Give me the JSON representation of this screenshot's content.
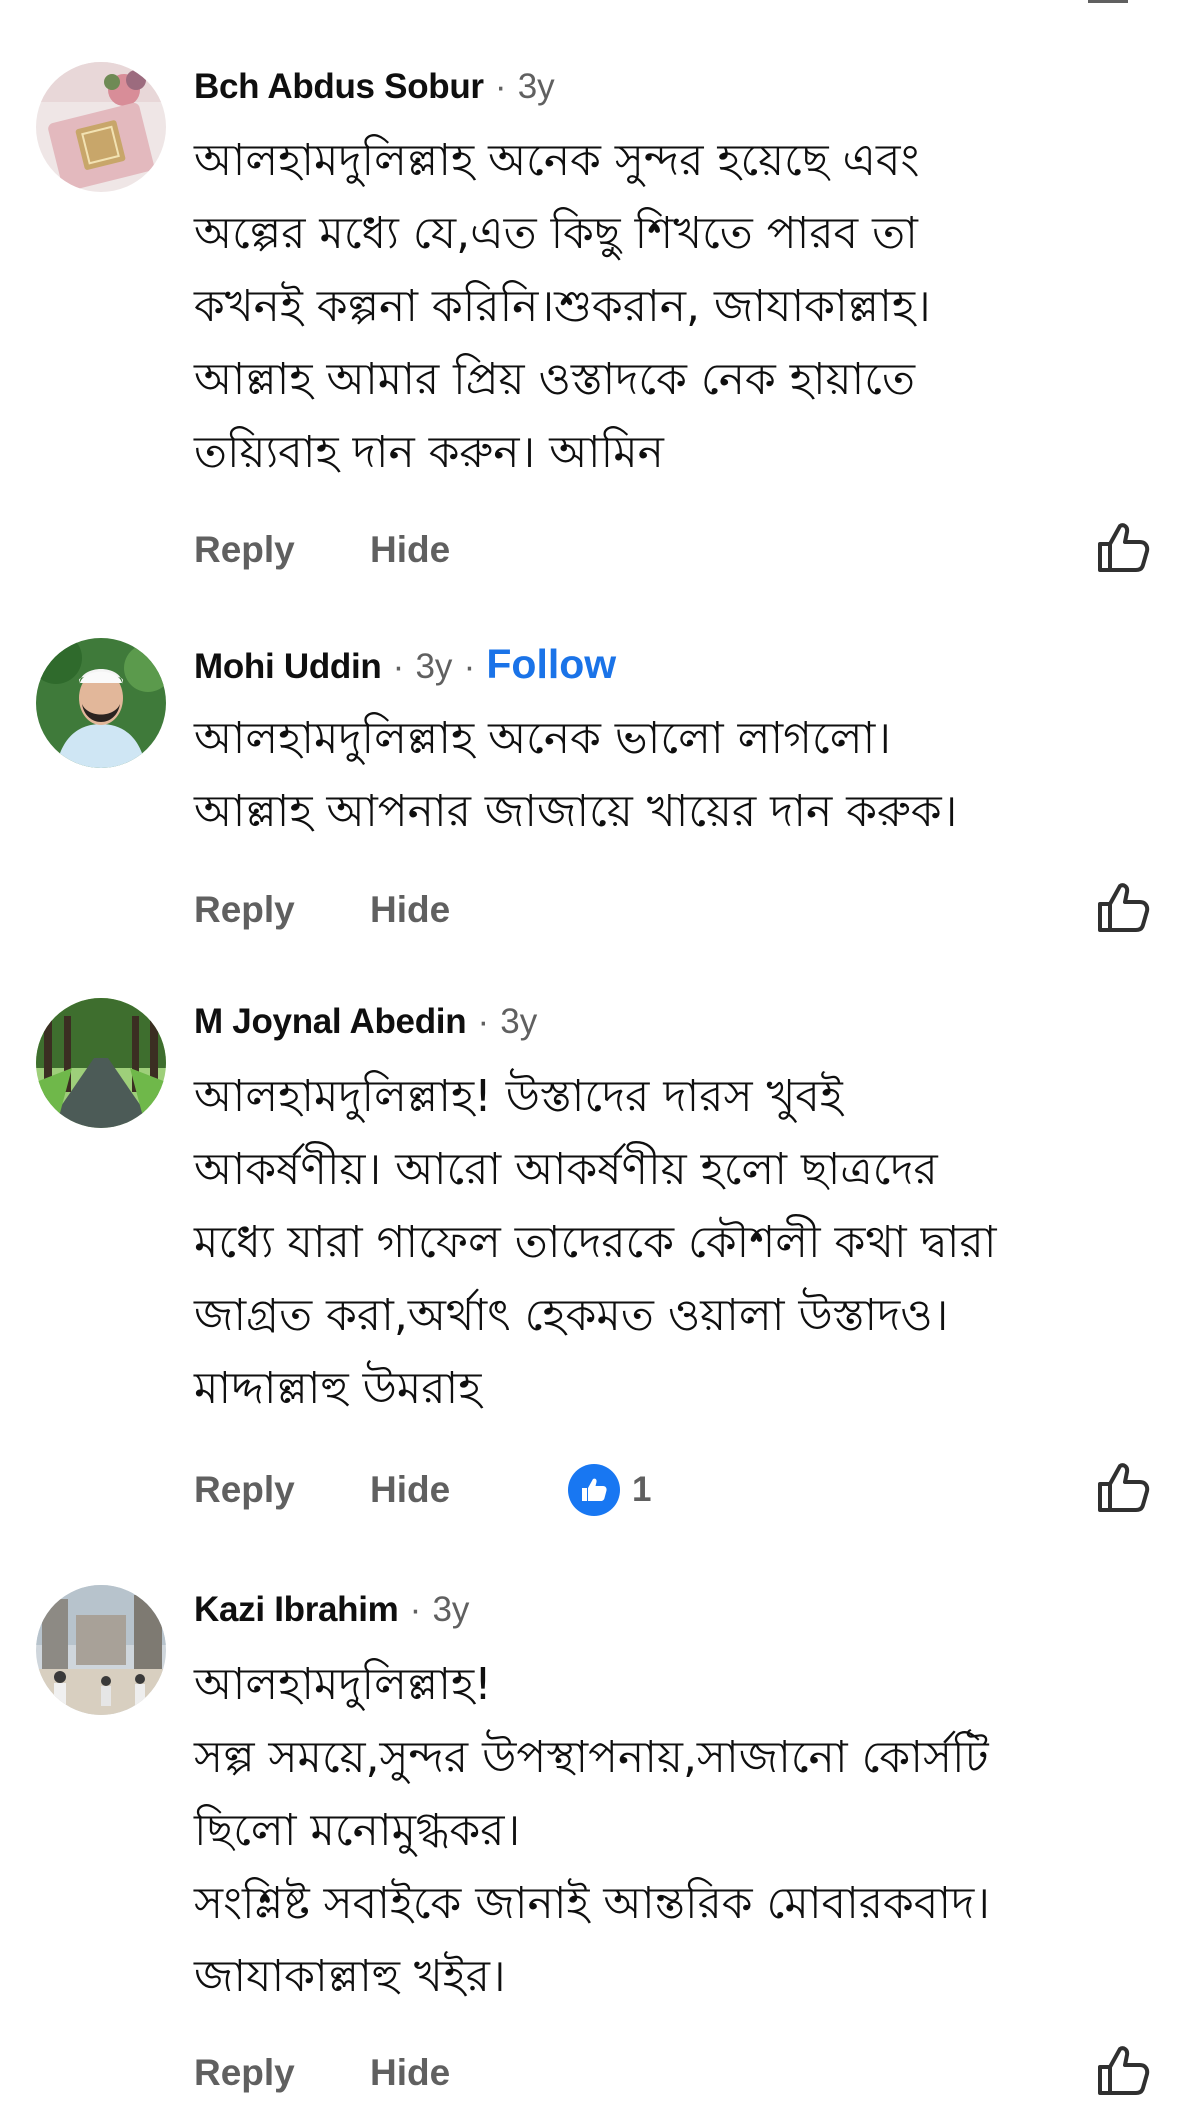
{
  "comments": [
    {
      "author": "Bch Abdus Sobur",
      "age": "3y",
      "follow": "",
      "text": "আলহামদুলিল্লাহ অনেক সুন্দর হয়েছে এবং\nঅল্পের মধ্যে যে,এত কিছু শিখতে পারব তা\nকখনই কল্পনা করিনি।শুকরান, জাযাকাল্লাহ।\nআল্লাহ আমার  প্রিয় ওস্তাদকে নেক হায়াতে\nতয়্যিবাহ দান করুন। আমিন",
      "reply": "Reply",
      "hide": "Hide",
      "likes": ""
    },
    {
      "author": "Mohi Uddin",
      "age": "3y",
      "follow": "Follow",
      "text": "আলহামদুলিল্লাহ অনেক ভালো লাগলো।\nআল্লাহ আপনার জাজায়ে খায়ের দান করুক।",
      "reply": "Reply",
      "hide": "Hide",
      "likes": ""
    },
    {
      "author": "M Joynal Abedin",
      "age": "3y",
      "follow": "",
      "text": "আলহামদুলিল্লাহ! উস্তাদের দারস খুবই\nআকর্ষণীয়। আরো আকর্ষণীয় হলো ছাত্রদের\nমধ্যে যারা গাফেল তাদেরকে  কৌশলী কথা দ্বারা\nজাগ্রত করা,অর্থাৎ হেকমত ওয়ালা উস্তাদও।\nমাদ্দাল্লাহু উমরাহ",
      "reply": "Reply",
      "hide": "Hide",
      "likes": "1"
    },
    {
      "author": "Kazi Ibrahim",
      "age": "3y",
      "follow": "",
      "text": "আলহামদুলিল্লাহ!\nসল্প সময়ে,সুন্দর উপস্থাপনায়,সাজানো কোর্সটি\nছিলো মনোমুগ্ধকর।\nসংশ্লিষ্ট সবাইকে জানাই আন্তরিক মোবারকবাদ।\nজাযাকাল্লাহু খইর।",
      "reply": "Reply",
      "hide": "Hide",
      "likes": ""
    }
  ],
  "separator": "·",
  "icons": {
    "like": "thumbs-up-outline-icon",
    "like_badge": "thumbs-up-filled-badge-icon"
  },
  "colors": {
    "link_blue": "#1a73e8",
    "badge_blue": "#1877f2",
    "secondary_text": "#606060",
    "primary_text": "#0f0f0f"
  }
}
